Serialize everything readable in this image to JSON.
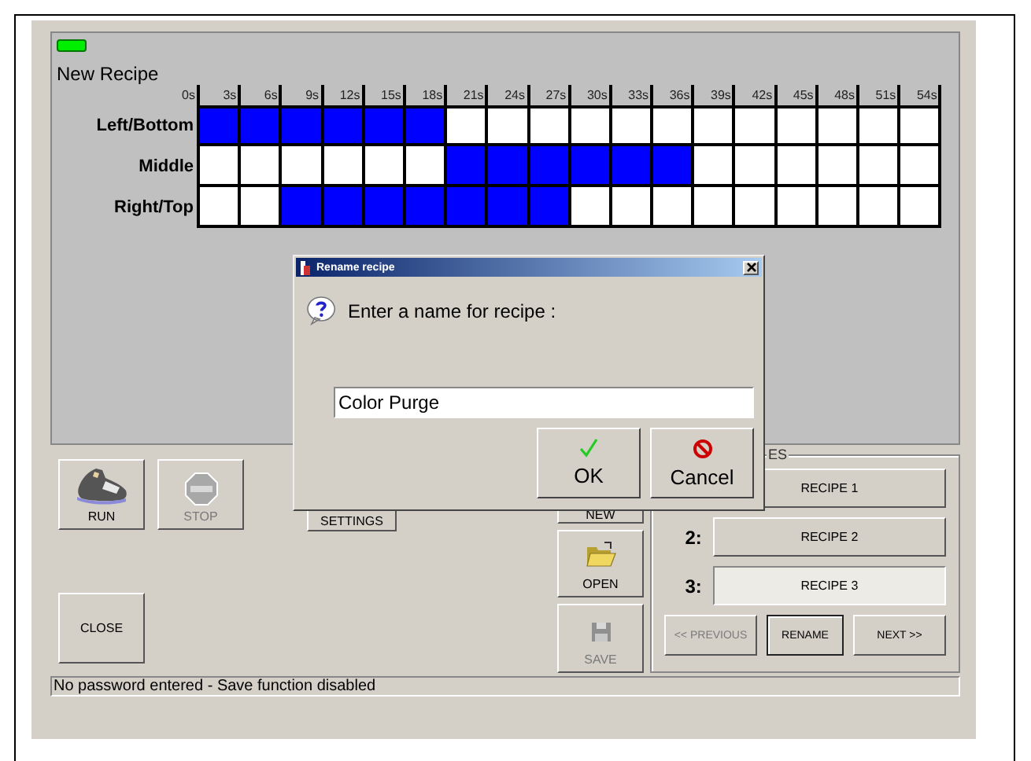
{
  "status_led": {
    "on": true
  },
  "recipe_title": "New Recipe",
  "timeline": {
    "ticks": [
      "0s",
      "3s",
      "6s",
      "9s",
      "12s",
      "15s",
      "18s",
      "21s",
      "24s",
      "27s",
      "30s",
      "33s",
      "36s",
      "39s",
      "42s",
      "45s",
      "48s",
      "51s",
      "54s"
    ],
    "rows": [
      {
        "label": "Left/Bottom",
        "cells": [
          true,
          true,
          true,
          true,
          true,
          true,
          false,
          false,
          false,
          false,
          false,
          false,
          false,
          false,
          false,
          false,
          false,
          false
        ]
      },
      {
        "label": "Middle",
        "cells": [
          false,
          false,
          false,
          false,
          false,
          false,
          true,
          true,
          true,
          true,
          true,
          true,
          false,
          false,
          false,
          false,
          false,
          false
        ]
      },
      {
        "label": "Right/Top",
        "cells": [
          false,
          false,
          true,
          true,
          true,
          true,
          true,
          true,
          true,
          false,
          false,
          false,
          false,
          false,
          false,
          false,
          false,
          false
        ]
      }
    ]
  },
  "run_buttons": [
    {
      "kind": "run",
      "label": "RUN",
      "disabled": false
    },
    {
      "kind": "stop",
      "label": "STOP",
      "disabled": true
    }
  ],
  "settings_button": {
    "label": "SETTINGS"
  },
  "close_button": {
    "label": "CLOSE"
  },
  "file_buttons": [
    {
      "kind": "new",
      "label": "NEW"
    },
    {
      "kind": "open",
      "label": "OPEN",
      "disabled": false
    },
    {
      "kind": "save",
      "label": "SAVE",
      "disabled": true
    }
  ],
  "recipes": {
    "legend": "ES",
    "slots": [
      {
        "name": "RECIPE 1",
        "selected": false
      },
      {
        "number": "2:",
        "name": "RECIPE 2",
        "selected": false
      },
      {
        "number": "3:",
        "name": "RECIPE 3",
        "selected": true
      }
    ],
    "nav": [
      {
        "label": "<< PREVIOUS",
        "disabled": true,
        "focused": false
      },
      {
        "label": "RENAME",
        "disabled": false,
        "focused": true
      },
      {
        "label": "NEXT >>",
        "disabled": false,
        "focused": false
      }
    ]
  },
  "status_bar": "No password entered - Save function disabled",
  "dialog": {
    "title": "Rename recipe",
    "prompt": "Enter a name for recipe :",
    "value": "Color Purge",
    "buttons": [
      {
        "kind": "ok",
        "label": "OK"
      },
      {
        "kind": "cancel",
        "label": "Cancel"
      }
    ]
  }
}
